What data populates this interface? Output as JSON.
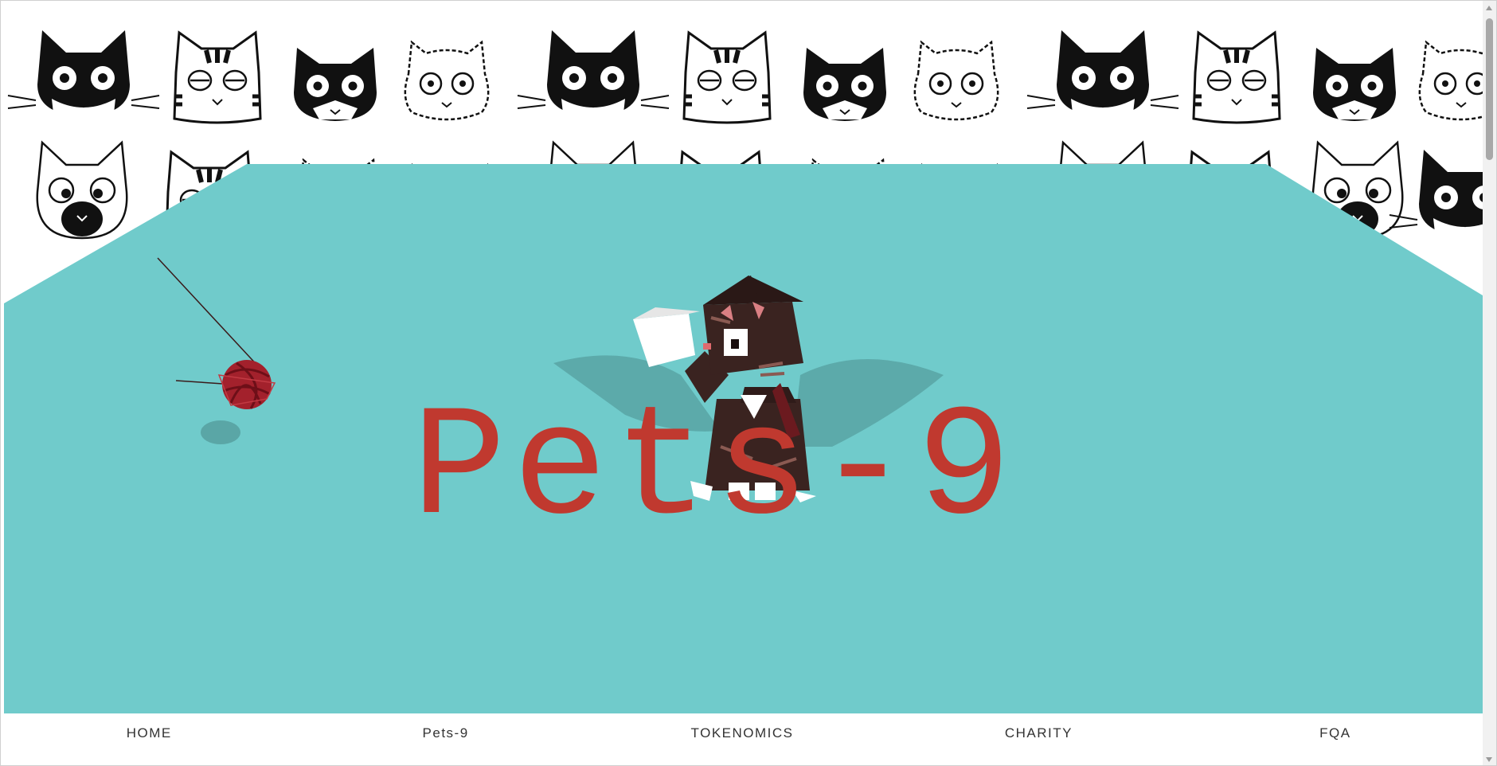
{
  "hero": {
    "title": "Pets-9",
    "background_color": "#70cbcb",
    "title_color": "#c0392f"
  },
  "nav": {
    "items": [
      {
        "label": "HOME"
      },
      {
        "label": "Pets-9"
      },
      {
        "label": "TOKENOMICS"
      },
      {
        "label": "CHARITY"
      },
      {
        "label": "FQA"
      }
    ]
  },
  "icons": {
    "pattern": "cat-face-icon",
    "cat": "voxel-cat-icon",
    "yarn": "yarn-ball-icon"
  }
}
